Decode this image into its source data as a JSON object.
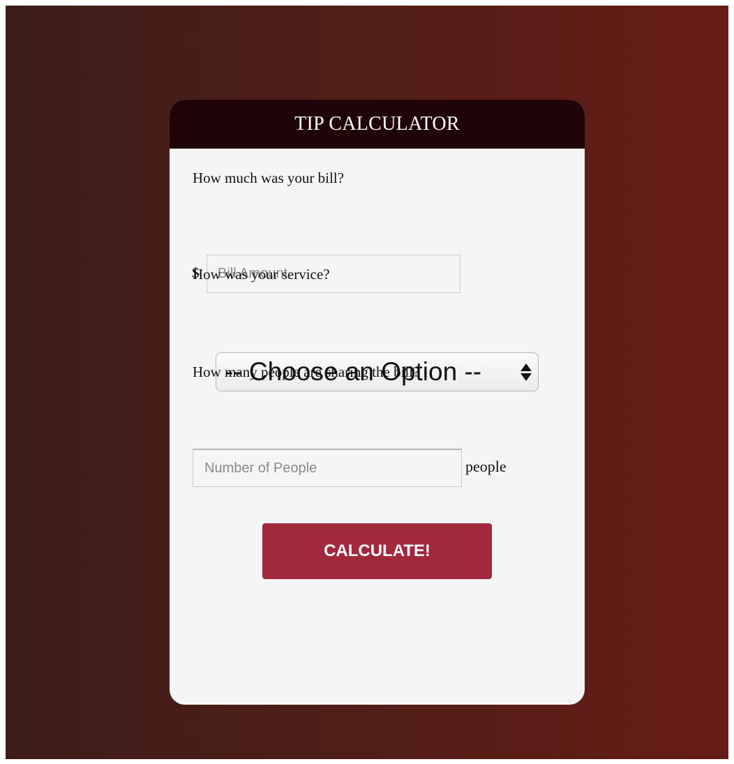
{
  "calculator": {
    "title": "TIP CALCULATOR",
    "bill_question": "How much was your bill?",
    "currency_symbol": "$",
    "bill_placeholder": "Bill Amount",
    "service_question": "How was your service?",
    "service_selected": "-- Choose an Option --",
    "people_question": "How many people are sharing the bill?",
    "people_placeholder": "Number of People",
    "people_suffix": "people",
    "calculate_label": "CALCULATE!"
  },
  "colors": {
    "header_bg": "#1f0509",
    "button_bg": "#a2283e",
    "card_bg": "#f5f5f5",
    "backdrop_left": "#3e1d18",
    "backdrop_right": "#671d15"
  },
  "icons": {
    "select_arrow": "updown-chevron-icon"
  }
}
